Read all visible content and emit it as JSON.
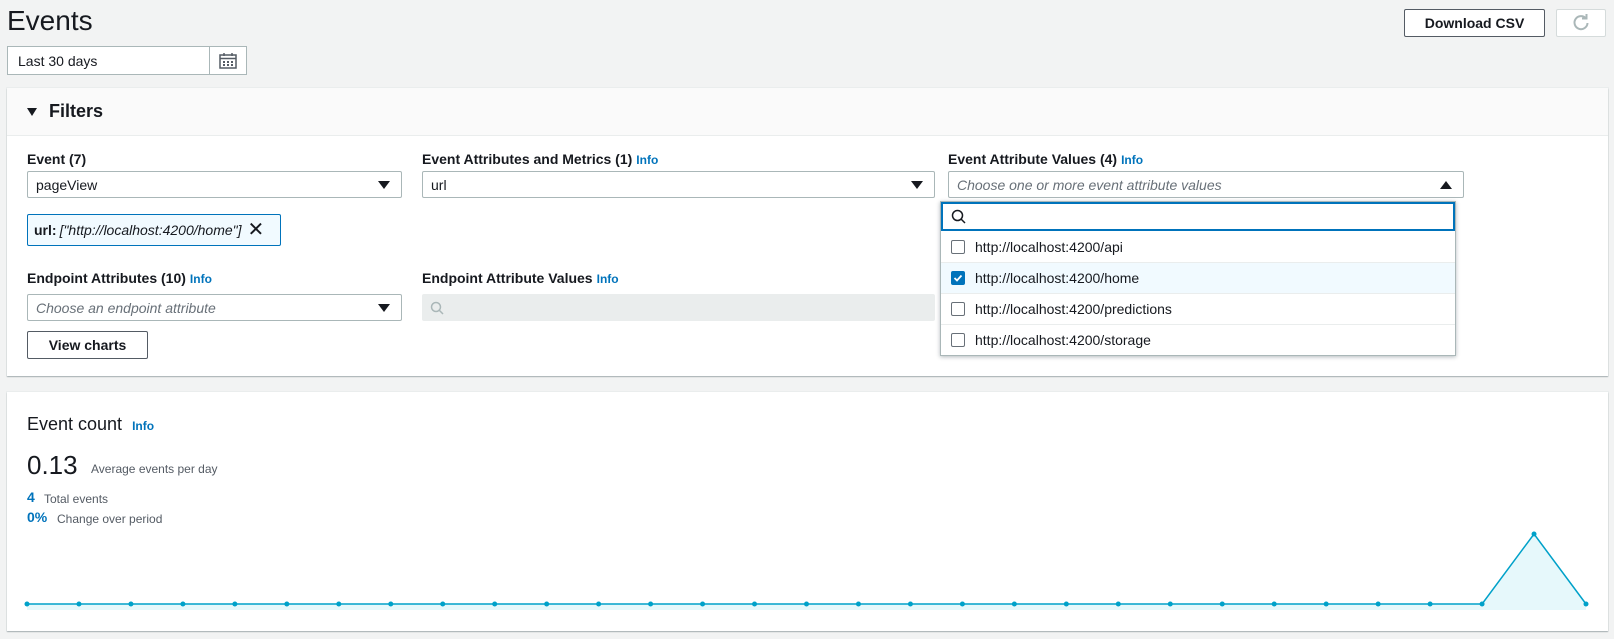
{
  "page": {
    "title": "Events"
  },
  "header": {
    "download_label": "Download CSV",
    "refresh_icon": "refresh-icon"
  },
  "date_range": {
    "value": "Last 30 days",
    "icon": "calendar-icon"
  },
  "filters": {
    "title": "Filters",
    "event": {
      "label": "Event (7)",
      "value": "pageView"
    },
    "attributes_metrics": {
      "label": "Event Attributes and Metrics (1)",
      "info": "Info",
      "value": "url"
    },
    "attribute_values": {
      "label": "Event Attribute Values (4)",
      "info": "Info",
      "placeholder": "Choose one or more event attribute values",
      "options": [
        {
          "label": "http://localhost:4200/api",
          "checked": false
        },
        {
          "label": "http://localhost:4200/home",
          "checked": true
        },
        {
          "label": "http://localhost:4200/predictions",
          "checked": false
        },
        {
          "label": "http://localhost:4200/storage",
          "checked": false
        }
      ]
    },
    "token": {
      "key": "url:",
      "value": "[\"http://localhost:4200/home\"]"
    },
    "endpoint_attributes": {
      "label": "Endpoint Attributes (10)",
      "info": "Info",
      "placeholder": "Choose an endpoint attribute"
    },
    "endpoint_values": {
      "label": "Endpoint Attribute Values",
      "info": "Info"
    },
    "view_charts_label": "View charts"
  },
  "event_count": {
    "title": "Event count",
    "info": "Info",
    "average": "0.13",
    "average_label": "Average events per day",
    "total": "4",
    "total_label": "Total events",
    "change": "0%",
    "change_label": "Change over period"
  },
  "chart_data": {
    "type": "area",
    "color": "#00a1c9",
    "fill": "#e6f8fb",
    "values": [
      0,
      0,
      0,
      0,
      0,
      0,
      0,
      0,
      0,
      0,
      0,
      0,
      0,
      0,
      0,
      0,
      0,
      0,
      0,
      0,
      0,
      0,
      0,
      0,
      0,
      0,
      0,
      0,
      0,
      4,
      0
    ]
  }
}
